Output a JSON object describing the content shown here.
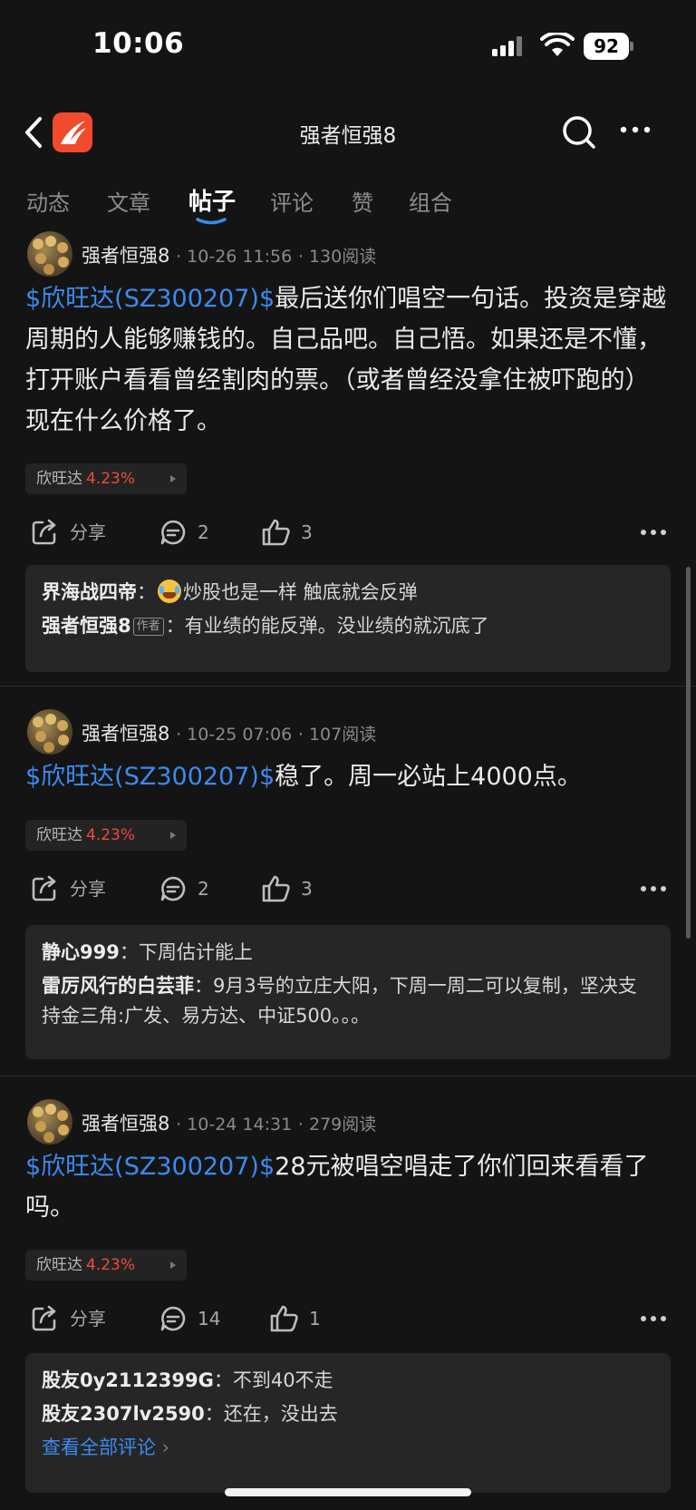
{
  "status_bar": {
    "time": "10:06",
    "battery": "92"
  },
  "nav": {
    "title": "强者恒强8"
  },
  "tabs": [
    {
      "label": "动态"
    },
    {
      "label": "文章"
    },
    {
      "label": "帖子"
    },
    {
      "label": "评论"
    },
    {
      "label": "赞"
    },
    {
      "label": "组合"
    }
  ],
  "active_tab": "帖子",
  "posts": [
    {
      "author": "强者恒强8",
      "datetime": "10-26 11:56",
      "reads": "130阅读",
      "stock_link": "$欣旺达(SZ300207)$",
      "text": "最后送你们唱空一句话。投资是穿越周期的人能够赚钱的。自己品吧。自己悟。如果还是不懂，打开账户看看曾经割肉的票。（或者曾经没拿住被吓跑的）现在什么价格了。",
      "tag_name": "欣旺达",
      "tag_change": "4.23%",
      "share_label": "分享",
      "comment_count": "2",
      "like_count": "3",
      "comments": [
        {
          "user": "界海战四帝",
          "sep": "：",
          "text": "炒股也是一样 触底就会反弹"
        },
        {
          "user": "强者恒强8",
          "badge": "作者",
          "sep": "：",
          "text": "有业绩的能反弹。没业绩的就沉底了"
        }
      ]
    },
    {
      "author": "强者恒强8",
      "datetime": "10-25 07:06",
      "reads": "107阅读",
      "stock_link": "$欣旺达(SZ300207)$",
      "text": "稳了。周一必站上4000点。",
      "tag_name": "欣旺达",
      "tag_change": "4.23%",
      "share_label": "分享",
      "comment_count": "2",
      "like_count": "3",
      "comments": [
        {
          "user": "静心999",
          "sep": "：",
          "text": "下周估计能上"
        },
        {
          "user": "雷厉风行的白芸菲",
          "sep": "：",
          "text": "9月3号的立庄大阳，下周一周二可以复制，坚决支持金三角:广发、易方达、中证500。。。"
        }
      ]
    },
    {
      "author": "强者恒强8",
      "datetime": "10-24 14:31",
      "reads": "279阅读",
      "stock_link": "$欣旺达(SZ300207)$",
      "text": "28元被唱空唱走了你们回来看看了吗。",
      "tag_name": "欣旺达",
      "tag_change": "4.23%",
      "share_label": "分享",
      "comment_count": "14",
      "like_count": "1",
      "comments": [
        {
          "user": "股友0y2112399G",
          "sep": "：",
          "text": "不到40不走"
        },
        {
          "user": "股友2307lv2590",
          "sep": "：",
          "text": "还在，没出去"
        }
      ],
      "see_all": "查看全部评论"
    }
  ],
  "colors": {
    "link": "#3b8bef",
    "up": "#ef4a3a",
    "logo": "#f24a2c",
    "background": "#141414"
  },
  "icons": [
    "back-icon",
    "app-logo-icon",
    "search-icon",
    "more-icon",
    "share-icon",
    "comment-icon",
    "like-icon",
    "emoji-laugh-icon"
  ]
}
